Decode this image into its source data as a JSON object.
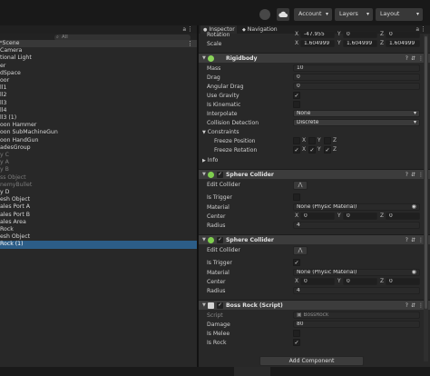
{
  "toolbar": {
    "account_label": "Account",
    "layers_label": "Layers",
    "layout_label": "Layout"
  },
  "hierarchy": {
    "search_placeholder": "All",
    "items": [
      {
        "label": "ᵒScene",
        "state": "scene"
      },
      {
        "label": " Camera",
        "state": "normal"
      },
      {
        "label": "tional Light",
        "state": "normal"
      },
      {
        "label": "er",
        "state": "normal"
      },
      {
        "label": "dSpace",
        "state": "normal"
      },
      {
        "label": "oor",
        "state": "normal"
      },
      {
        "label": "ll1",
        "state": "normal"
      },
      {
        "label": "ll2",
        "state": "normal"
      },
      {
        "label": "ll3",
        "state": "normal"
      },
      {
        "label": "ll4",
        "state": "normal"
      },
      {
        "label": "ll3 (1)",
        "state": "normal"
      },
      {
        "label": "oon Hammer",
        "state": "normal"
      },
      {
        "label": "oon SubMachineGun",
        "state": "normal"
      },
      {
        "label": "oon HandGun",
        "state": "normal"
      },
      {
        "label": "adesGroup",
        "state": "normal"
      },
      {
        "label": "y C",
        "state": "dim"
      },
      {
        "label": "y A",
        "state": "dim"
      },
      {
        "label": "y B",
        "state": "dim"
      },
      {
        "label": "ss Object",
        "state": "dim"
      },
      {
        "label": "nemyBullet",
        "state": "dim"
      },
      {
        "label": "y D",
        "state": "normal"
      },
      {
        "label": "esh Object",
        "state": "normal"
      },
      {
        "label": "ales Port A",
        "state": "normal"
      },
      {
        "label": "ales Port B",
        "state": "normal"
      },
      {
        "label": "ales Area",
        "state": "normal"
      },
      {
        "label": " Rock",
        "state": "normal"
      },
      {
        "label": "esh Object",
        "state": "normal"
      },
      {
        "label": " Rock (1)",
        "state": "selected"
      }
    ]
  },
  "inspector": {
    "tab_inspector": "Inspector",
    "tab_navigation": "Navigation",
    "transform": {
      "rotation_label": "Rotation",
      "rotation": {
        "x": "-47.955",
        "y": "0",
        "z": "0"
      },
      "scale_label": "Scale",
      "scale": {
        "x": "1.604999",
        "y": "1.604999",
        "z": "1.604999"
      }
    },
    "rigidbody": {
      "title": "Rigidbody",
      "mass_label": "Mass",
      "mass": "10",
      "drag_label": "Drag",
      "drag": "0",
      "angular_drag_label": "Angular Drag",
      "angular_drag": "0",
      "use_gravity_label": "Use Gravity",
      "use_gravity": true,
      "is_kinematic_label": "Is Kinematic",
      "is_kinematic": false,
      "interpolate_label": "Interpolate",
      "interpolate": "None",
      "collision_detection_label": "Collision Detection",
      "collision_detection": "Discrete",
      "constraints_label": "Constraints",
      "freeze_position_label": "Freeze Position",
      "freeze_position": {
        "x": false,
        "y": false,
        "z": false
      },
      "freeze_rotation_label": "Freeze Rotation",
      "freeze_rotation": {
        "x": true,
        "y": true,
        "z": true
      },
      "info_label": "Info"
    },
    "sphere_collider_1": {
      "title": "Sphere Collider",
      "edit_collider_label": "Edit Collider",
      "is_trigger_label": "Is Trigger",
      "is_trigger": false,
      "material_label": "Material",
      "material": "None (Physic Material)",
      "center_label": "Center",
      "center": {
        "x": "0",
        "y": "0",
        "z": "0"
      },
      "radius_label": "Radius",
      "radius": "4"
    },
    "sphere_collider_2": {
      "title": "Sphere Collider",
      "edit_collider_label": "Edit Collider",
      "is_trigger_label": "Is Trigger",
      "is_trigger": true,
      "material_label": "Material",
      "material": "None (Physic Material)",
      "center_label": "Center",
      "center": {
        "x": "0",
        "y": "0",
        "z": "0"
      },
      "radius_label": "Radius",
      "radius": "4"
    },
    "boss_rock": {
      "title": "Boss Rock (Script)",
      "script_label": "Script",
      "script": "BossRock",
      "damage_label": "Damage",
      "damage": "80",
      "is_melee_label": "Is Melee",
      "is_melee": false,
      "is_rock_label": "Is Rock",
      "is_rock": true
    },
    "add_component_label": "Add Component",
    "axis_labels": {
      "x": "X",
      "y": "Y",
      "z": "Z"
    }
  },
  "icons": {
    "collab": "cloud-icon",
    "history": "history-icon",
    "lock": "lock-icon",
    "menu": "kebab-menu-icon",
    "help": "help-icon",
    "preset": "preset-icon"
  },
  "colors": {
    "selection": "#2c5d87",
    "panel": "#282828",
    "header": "#3c3c3c",
    "rigidbody_icon": "#8ad45a",
    "collider_icon": "#7fce4e",
    "script_icon": "#d4d4d4"
  }
}
